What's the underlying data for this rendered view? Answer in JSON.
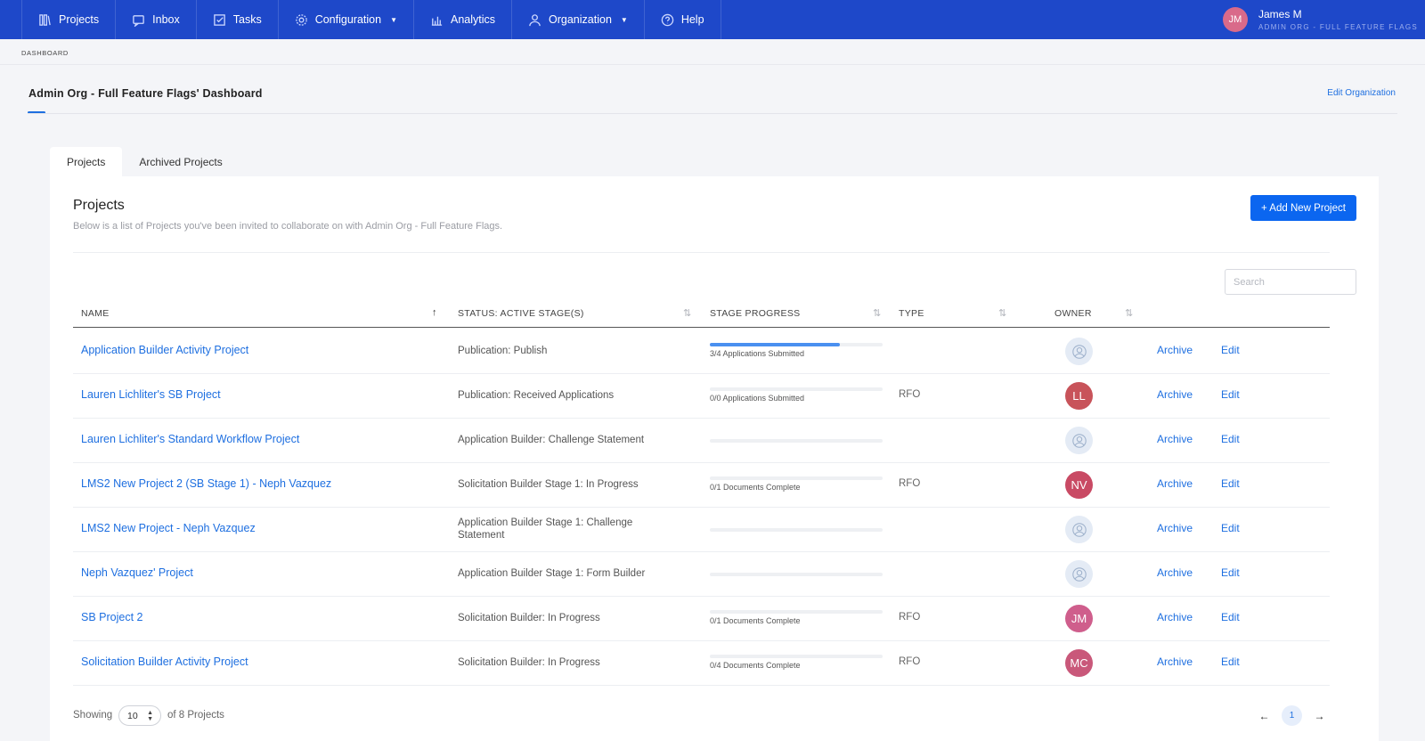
{
  "nav": {
    "items": [
      {
        "label": "Projects",
        "icon": "projects-icon",
        "caret": false
      },
      {
        "label": "Inbox",
        "icon": "inbox-icon",
        "caret": false
      },
      {
        "label": "Tasks",
        "icon": "tasks-icon",
        "caret": false
      },
      {
        "label": "Configuration",
        "icon": "gear-icon",
        "caret": true
      },
      {
        "label": "Analytics",
        "icon": "analytics-icon",
        "caret": false
      },
      {
        "label": "Organization",
        "icon": "organization-icon",
        "caret": true
      },
      {
        "label": "Help",
        "icon": "help-icon",
        "caret": false
      }
    ],
    "user": {
      "initials": "JM",
      "name": "James M",
      "org": "ADMIN ORG - FULL FEATURE FLAGS"
    },
    "bg_color": "#1e48c9"
  },
  "breadcrumb": "DASHBOARD",
  "page": {
    "title": "Admin Org - Full Feature Flags' Dashboard",
    "edit_org": "Edit Organization"
  },
  "tabs": [
    {
      "label": "Projects",
      "active": true
    },
    {
      "label": "Archived Projects",
      "active": false
    }
  ],
  "card": {
    "title": "Projects",
    "subtitle": "Below is a list of Projects you've been invited to collaborate on with Admin Org - Full Feature Flags.",
    "add_button": "+ Add New Project",
    "search_placeholder": "Search"
  },
  "table": {
    "columns": [
      "NAME",
      "STATUS: ACTIVE STAGE(S)",
      "STAGE PROGRESS",
      "TYPE",
      "OWNER"
    ],
    "rows": [
      {
        "name": "Application Builder Activity Project",
        "status": "Publication: Publish",
        "progress": 0.75,
        "progress_text": "3/4 Applications Submitted",
        "type": "",
        "owner": "",
        "owner_color": ""
      },
      {
        "name": "Lauren Lichliter's SB Project",
        "status": "Publication: Received Applications",
        "progress": 0,
        "progress_text": "0/0 Applications Submitted",
        "type": "RFO",
        "owner": "LL",
        "owner_color": "#c8535a"
      },
      {
        "name": "Lauren Lichliter's Standard Workflow Project",
        "status": "Application Builder: Challenge Statement",
        "progress": 0,
        "progress_text": "",
        "type": "",
        "owner": "",
        "owner_color": ""
      },
      {
        "name": "LMS2 New Project 2 (SB Stage 1) - Neph Vazquez",
        "status": "Solicitation Builder Stage 1: In Progress",
        "progress": 0,
        "progress_text": "0/1 Documents Complete",
        "type": "RFO",
        "owner": "NV",
        "owner_color": "#c94a64"
      },
      {
        "name": "LMS2 New Project - Neph Vazquez",
        "status": "Application Builder Stage 1: Challenge Statement",
        "progress": 0,
        "progress_text": "",
        "type": "",
        "owner": "",
        "owner_color": ""
      },
      {
        "name": "Neph Vazquez' Project",
        "status": "Application Builder Stage 1: Form Builder",
        "progress": 0,
        "progress_text": "",
        "type": "",
        "owner": "",
        "owner_color": ""
      },
      {
        "name": "SB Project 2",
        "status": "Solicitation Builder: In Progress",
        "progress": 0,
        "progress_text": "0/1 Documents Complete",
        "type": "RFO",
        "owner": "JM",
        "owner_color": "#cf5e8c"
      },
      {
        "name": "Solicitation Builder Activity Project",
        "status": "Solicitation Builder: In Progress",
        "progress": 0,
        "progress_text": "0/4 Documents Complete",
        "type": "RFO",
        "owner": "MC",
        "owner_color": "#c9587a"
      }
    ],
    "archive_label": "Archive",
    "edit_label": "Edit"
  },
  "footer": {
    "showing": "Showing",
    "page_size": "10",
    "of_text": "of 8 Projects",
    "current_page": "1",
    "prev": "←",
    "next": "→"
  }
}
